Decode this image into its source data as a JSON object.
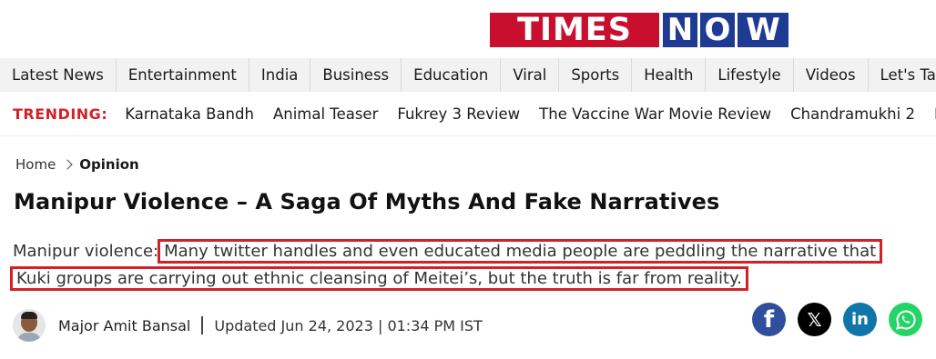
{
  "logo": {
    "left": "TIMES",
    "n": "N",
    "o": "O",
    "w": "W"
  },
  "nav": {
    "items": [
      "Latest News",
      "Entertainment",
      "India",
      "Business",
      "Education",
      "Viral",
      "Sports",
      "Health",
      "Lifestyle",
      "Videos",
      "Let's Talk"
    ]
  },
  "trending": {
    "label": "TRENDING:",
    "items": [
      "Karnataka Bandh",
      "Animal Teaser",
      "Fukrey 3 Review",
      "The Vaccine War Movie Review",
      "Chandramukhi 2",
      "IN"
    ]
  },
  "breadcrumb": {
    "home": "Home",
    "current": "Opinion"
  },
  "article": {
    "headline": "Manipur Violence – A Saga Of Myths And Fake Narratives",
    "summary_prefix": "Manipur violence:",
    "summary_line1": "Many twitter handles and even educated media people are peddling the narrative that",
    "summary_line2": "Kuki groups are carrying out ethnic cleansing of Meitei’s, but the truth is far from reality."
  },
  "byline": {
    "author": "Major Amit Bansal",
    "updated": "Updated Jun 24, 2023 | 01:34 PM IST"
  },
  "share": {
    "facebook": "f",
    "x": "𝕏",
    "linkedin": "in"
  },
  "colors": {
    "brand_red": "#c8102e",
    "brand_blue": "#1f3a93",
    "highlight_border": "#d12229",
    "trending_red": "#d12229"
  }
}
